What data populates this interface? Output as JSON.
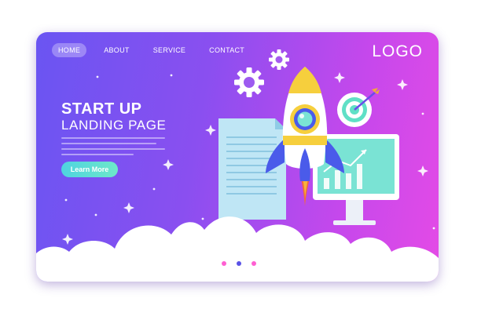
{
  "nav": {
    "items": [
      {
        "label": "HOME",
        "active": true
      },
      {
        "label": "ABOUT",
        "active": false
      },
      {
        "label": "SERVICE",
        "active": false
      },
      {
        "label": "CONTACT",
        "active": false
      }
    ]
  },
  "brand": {
    "logo_text": "LOGO"
  },
  "hero": {
    "title": "START UP",
    "subtitle": "LANDING PAGE",
    "cta_label": "Learn More"
  },
  "icons": [
    "gear-icon",
    "target-icon",
    "rocket-icon",
    "document-icon",
    "monitor-icon",
    "sparkle-icon",
    "cloud-icon"
  ],
  "pagination": {
    "count": 3,
    "active_index": 1
  },
  "colors": {
    "gradient_start": "#6a55f2",
    "gradient_end": "#e44be6",
    "cta": "#4fd3e0",
    "dot_pink": "#ff5fd2",
    "dot_active": "#5a52e6"
  }
}
